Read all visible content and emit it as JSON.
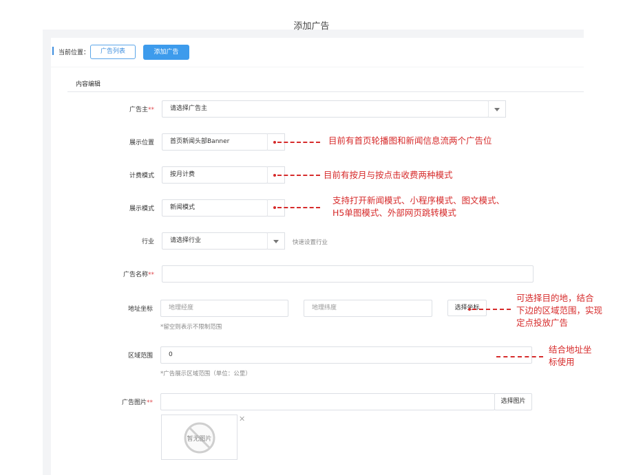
{
  "page": {
    "title": "添加广告"
  },
  "breadcrumb": {
    "label": "当前位置：",
    "list_button": "广告列表",
    "add_button": "添加广告"
  },
  "section": {
    "title": "内容编辑"
  },
  "form": {
    "advertiser": {
      "label": "广告主",
      "required_mark": "**",
      "value": "请选择广告主"
    },
    "position": {
      "label": "展示位置",
      "value": "首页新闻头部Banner"
    },
    "billing": {
      "label": "计费模式",
      "value": "按月计费"
    },
    "display_mode": {
      "label": "展示模式",
      "value": "新闻模式"
    },
    "industry": {
      "label": "行业",
      "value": "请选择行业",
      "quick_link": "快速设置行业"
    },
    "ad_name": {
      "label": "广告名称",
      "required_mark": "**",
      "value": ""
    },
    "address": {
      "label": "地址坐标",
      "lng_placeholder": "地理经度",
      "lat_placeholder": "地理纬度",
      "pick_button": "选择坐标",
      "hint": "*留空则表示不限制范围"
    },
    "range": {
      "label": "区域范围",
      "value": "0",
      "hint": "*广告展示区域范围（单位：公里）"
    },
    "image": {
      "label": "广告图片",
      "required_mark": "**",
      "value": "",
      "pick_button": "选择图片",
      "empty_text": "暂无图片",
      "close": "✕"
    }
  },
  "annotations": {
    "position_note": "目前有首页轮播图和新闻信息流两个广告位",
    "billing_note": "目前有按月与按点击收费两种模式",
    "display_note_line1": "支持打开新闻模式、小程序模式、图文模式、",
    "display_note_line2": "H5单图模式、外部网页跳转模式",
    "coord_note_line1": "可选择目的地，结合",
    "coord_note_line2": "下边的区域范围，实现",
    "coord_note_line3": "定点投放广告",
    "range_note_line1": "结合地址坐",
    "range_note_line2": "标使用"
  },
  "colors": {
    "accent": "#3c8dde",
    "primary_button": "#3d9bec",
    "annotation": "#d62a2a",
    "required": "#e0474c"
  }
}
